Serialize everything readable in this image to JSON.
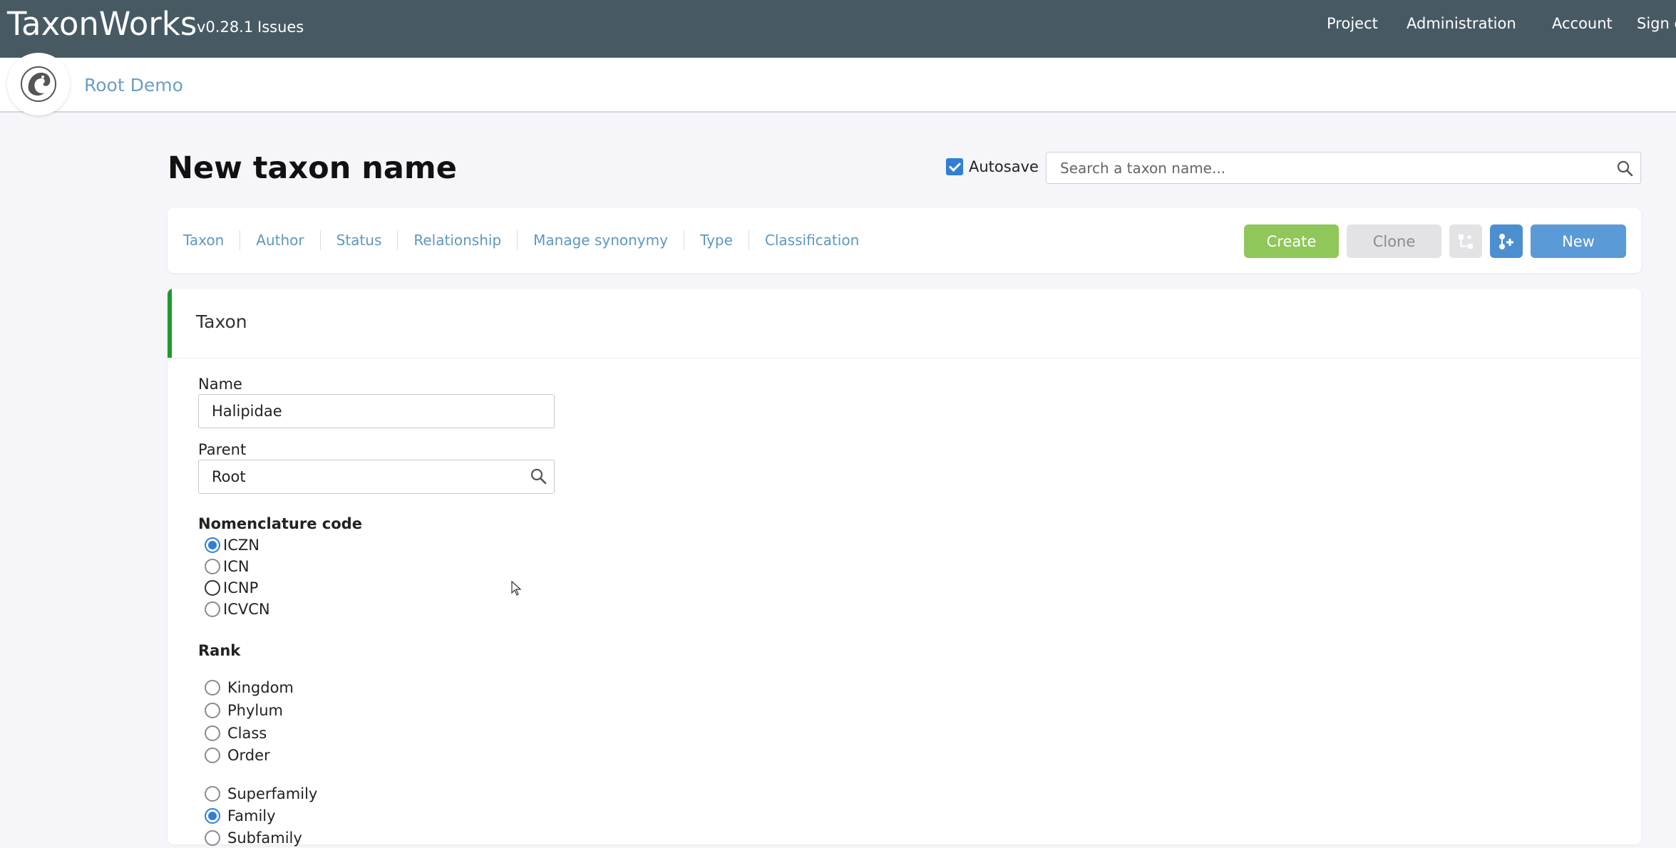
{
  "header": {
    "brand": "TaxonWorks",
    "version": "v0.28.1",
    "issues_label": "Issues",
    "nav": [
      "Project",
      "Administration",
      "Account",
      "Sign o"
    ]
  },
  "project": {
    "name": "Root Demo"
  },
  "page": {
    "title": "New taxon name",
    "autosave_label": "Autosave",
    "autosave_checked": true,
    "search_placeholder": "Search a taxon name..."
  },
  "tabs": [
    "Taxon",
    "Author",
    "Status",
    "Relationship",
    "Manage synonymy",
    "Type",
    "Classification"
  ],
  "toolbar": {
    "create_label": "Create",
    "clone_label": "Clone",
    "new_label": "New"
  },
  "taxon_section": {
    "title": "Taxon",
    "name_label": "Name",
    "name_value": "Halipidae",
    "parent_label": "Parent",
    "parent_value": "Root",
    "nomenclature_label": "Nomenclature code",
    "nomenclature_options": [
      "ICZN",
      "ICN",
      "ICNP",
      "ICVCN"
    ],
    "nomenclature_selected": "ICZN",
    "rank_label": "Rank",
    "rank_group_1": [
      "Kingdom",
      "Phylum",
      "Class",
      "Order"
    ],
    "rank_group_2": [
      "Superfamily",
      "Family",
      "Subfamily"
    ],
    "rank_selected": "Family"
  },
  "colors": {
    "topbar": "#475a64",
    "create": "#8fc75a",
    "new": "#5a9ad6",
    "accent": "#1d9b2c"
  }
}
